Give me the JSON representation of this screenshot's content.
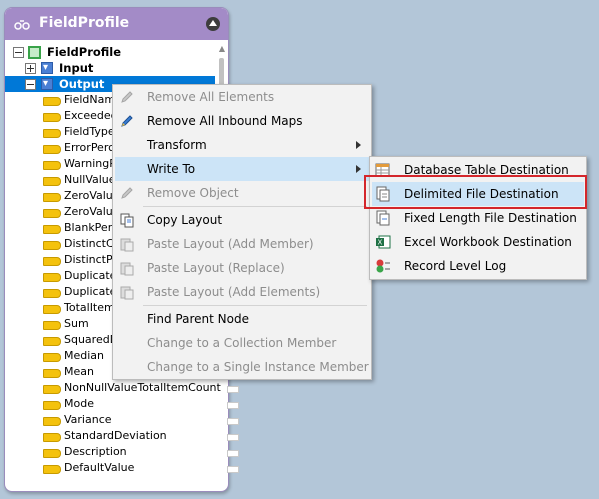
{
  "panel": {
    "title": "FieldProfile",
    "tree": {
      "root_label": "FieldProfile",
      "input_label": "Input",
      "output_label": "Output",
      "fields": [
        "FieldName",
        "ExceededI",
        "FieldTypeI",
        "ErrorPerce",
        "WarningP",
        "NullValueF",
        "ZeroValue",
        "ZeroValue",
        "BlankPerc",
        "DistinctCou",
        "DistinctPe",
        "DuplicateC",
        "DuplicateF",
        "TotalItems",
        "Sum",
        "SquaredDu",
        "Median",
        "Mean",
        "NonNullValueTotalItemCount",
        "Mode",
        "Variance",
        "StandardDeviation",
        "Description",
        "DefaultValue"
      ]
    }
  },
  "context_menu": {
    "items": [
      {
        "label": "Remove All Elements",
        "icon": "pencil-icon",
        "disabled": true
      },
      {
        "label": "Remove All Inbound Maps",
        "icon": "pencil-icon",
        "disabled": false
      },
      {
        "label": "Transform",
        "icon": "",
        "disabled": false,
        "submenu": true
      },
      {
        "label": "Write To",
        "icon": "",
        "disabled": false,
        "submenu": true,
        "highlighted": true
      },
      {
        "label": "Remove Object",
        "icon": "pencil-icon",
        "disabled": true
      },
      {
        "label": "Copy Layout",
        "icon": "copy-icon",
        "disabled": false
      },
      {
        "label": "Paste Layout (Add Member)",
        "icon": "paste-icon",
        "disabled": true
      },
      {
        "label": "Paste Layout (Replace)",
        "icon": "paste-icon",
        "disabled": true
      },
      {
        "label": "Paste Layout (Add Elements)",
        "icon": "paste-icon",
        "disabled": true
      },
      {
        "label": "Find Parent Node",
        "icon": "",
        "disabled": false
      },
      {
        "label": "Change to a Collection Member",
        "icon": "",
        "disabled": true
      },
      {
        "label": "Change to a Single Instance Member",
        "icon": "",
        "disabled": true
      }
    ]
  },
  "write_to_submenu": {
    "items": [
      {
        "label": "Database Table Destination",
        "icon": "database-table-icon"
      },
      {
        "label": "Delimited File Destination",
        "icon": "delimited-file-icon",
        "highlighted": true
      },
      {
        "label": "Fixed Length File Destination",
        "icon": "fixed-length-file-icon"
      },
      {
        "label": "Excel Workbook Destination",
        "icon": "excel-icon"
      },
      {
        "label": "Record Level Log",
        "icon": "record-log-icon"
      }
    ]
  },
  "colors": {
    "header": "#a38bc7",
    "selection": "#0078d7",
    "menu_highlight": "#cce4f7",
    "annotation_box": "#d4262b"
  }
}
